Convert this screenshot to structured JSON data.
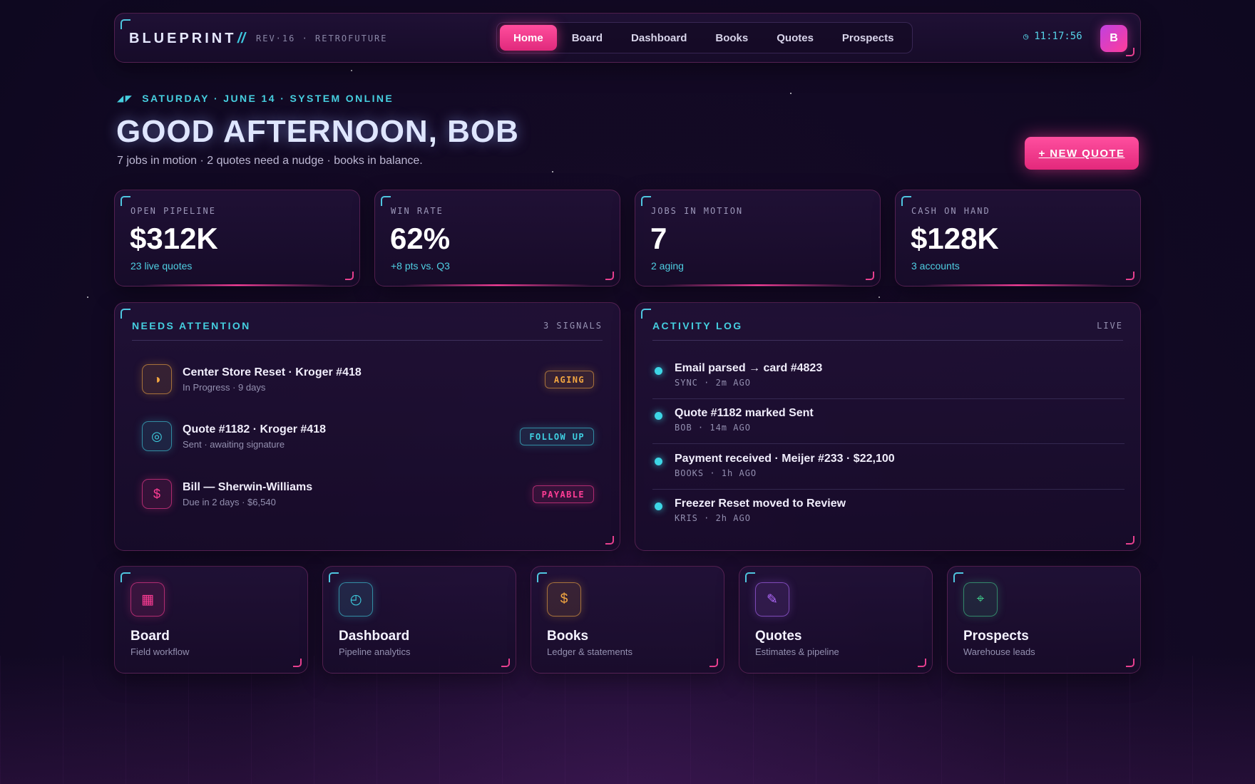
{
  "header": {
    "brand": "BLUEPRINT",
    "brand_slash": "//",
    "revision": "REV·16 · RETROFUTURE",
    "nav": [
      {
        "label": "Home",
        "active": true
      },
      {
        "label": "Board",
        "active": false
      },
      {
        "label": "Dashboard",
        "active": false
      },
      {
        "label": "Books",
        "active": false
      },
      {
        "label": "Quotes",
        "active": false
      },
      {
        "label": "Prospects",
        "active": false
      }
    ],
    "clock_icon": "clock-icon",
    "clock": "11:17:56",
    "avatar_initial": "B"
  },
  "greeting": {
    "dateline": "SATURDAY · JUNE 14 · SYSTEM ONLINE",
    "title": "GOOD AFTERNOON, BOB",
    "subtitle": "7 jobs in motion · 2 quotes need a nudge · books in balance.",
    "new_quote_label": "+ NEW QUOTE"
  },
  "kpis": [
    {
      "label": "OPEN PIPELINE",
      "value": "$312K",
      "sub": "23 live quotes"
    },
    {
      "label": "WIN RATE",
      "value": "62%",
      "sub": "+8 pts vs. Q3"
    },
    {
      "label": "JOBS IN MOTION",
      "value": "7",
      "sub": "2 aging"
    },
    {
      "label": "CASH ON HAND",
      "value": "$128K",
      "sub": "3 accounts"
    }
  ],
  "attention": {
    "title": "NEEDS ATTENTION",
    "meta": "3 SIGNALS",
    "items": [
      {
        "icon": "half-circle-icon",
        "glyph": "◑",
        "title": "Center Store Reset · Kroger #418",
        "sub": "In Progress · 9 days",
        "badge": "AGING",
        "color": "#f2a641"
      },
      {
        "icon": "target-ring-icon",
        "glyph": "◎",
        "title": "Quote #1182 · Kroger #418",
        "sub": "Sent · awaiting signature",
        "badge": "FOLLOW UP",
        "color": "#3fd0e2"
      },
      {
        "icon": "dollar-icon",
        "glyph": "$",
        "title": "Bill — Sherwin-Williams",
        "sub": "Due in 2 days · $6,540",
        "badge": "PAYABLE",
        "color": "#ff3d95"
      }
    ]
  },
  "activity": {
    "title": "ACTIVITY LOG",
    "meta": "LIVE",
    "items": [
      {
        "title": "Email parsed → card #4823",
        "meta": "SYNC · 2m AGO"
      },
      {
        "title": "Quote #1182 marked Sent",
        "meta": "BOB · 14m AGO"
      },
      {
        "title": "Payment received · Meijer #233 · $22,100",
        "meta": "BOOKS · 1h AGO"
      },
      {
        "title": "Freezer Reset moved to Review",
        "meta": "KRIS · 2h AGO"
      }
    ]
  },
  "tiles": [
    {
      "icon": "board-grid-icon",
      "glyph": "▦",
      "title": "Board",
      "sub": "Field workflow",
      "color": "#ff3d95"
    },
    {
      "icon": "dashboard-gauge-icon",
      "glyph": "◴",
      "title": "Dashboard",
      "sub": "Pipeline analytics",
      "color": "#3fd0e2"
    },
    {
      "icon": "books-dollar-icon",
      "glyph": "$",
      "title": "Books",
      "sub": "Ledger & statements",
      "color": "#f2a641"
    },
    {
      "icon": "quotes-pencil-icon",
      "glyph": "✎",
      "title": "Quotes",
      "sub": "Estimates & pipeline",
      "color": "#b36bff"
    },
    {
      "icon": "prospects-crosshair-icon",
      "glyph": "⌖",
      "title": "Prospects",
      "sub": "Warehouse leads",
      "color": "#3fc98a"
    }
  ]
}
